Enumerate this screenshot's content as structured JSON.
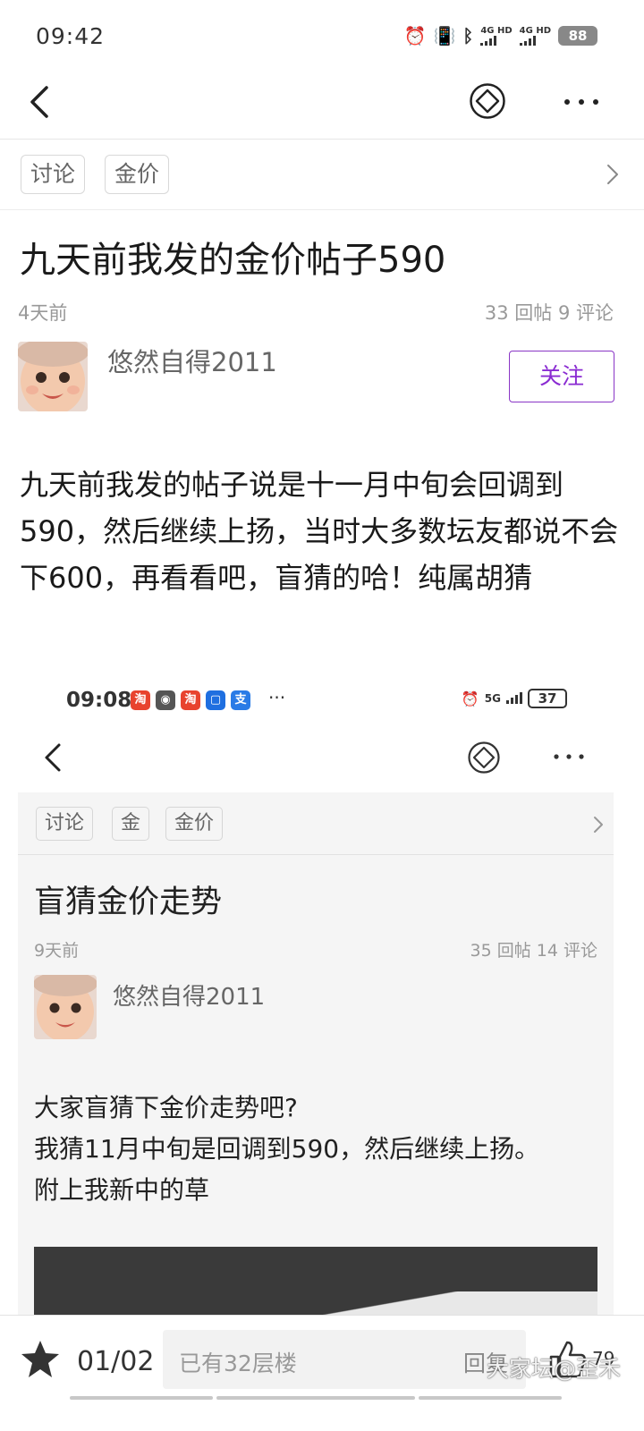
{
  "status_bar": {
    "time": "09:42",
    "signal1": "4G HD",
    "signal2": "4G HD",
    "battery": "88"
  },
  "tags": [
    "讨论",
    "金价"
  ],
  "post": {
    "title": "九天前我发的金价帖子590",
    "time": "4天前",
    "stats": "33 回帖  9 评论",
    "author": "悠然自得2011",
    "follow_label": "关注",
    "body": "九天前我发的帖子说是十一月中旬会回调到590，然后继续上扬，当时大多数坛友都说不会下600，再看看吧，盲猜的哈！纯属胡猜"
  },
  "embedded": {
    "status_time": "09:08",
    "status_signal": "5G",
    "battery": "37",
    "tags": [
      "讨论",
      "金",
      "金价"
    ],
    "title": "盲猜金价走势",
    "time": "9天前",
    "stats": "35 回帖  14 评论",
    "author": "悠然自得2011",
    "lines": [
      "大家盲猜下金价走势吧?",
      "我猜11月中旬是回调到590，然后继续上扬。",
      "附上我新中的草"
    ]
  },
  "bottom_bar": {
    "page": "01/02",
    "reply_placeholder": "已有32层楼",
    "reply_label": "回复",
    "like_count": "79",
    "watermark": "大家坛@歪禾"
  },
  "colors": {
    "accent": "#8a2bd2",
    "text": "#1a1a1a",
    "muted": "#999999"
  }
}
